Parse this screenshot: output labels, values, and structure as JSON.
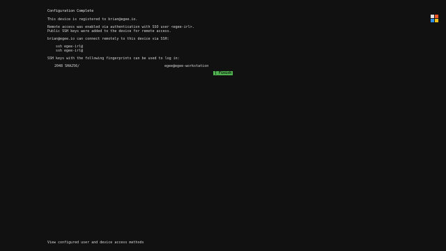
{
  "title": "Configuration Complete",
  "registration_line": "This device is registered to brian@egee.io.",
  "remote_access_line1": "Remote access was enabled via authentication with SSO user <egee-irl>.",
  "remote_access_line2": "Public SSH keys were added to the device for remote access.",
  "connect_intro": "brian@egee.io can connect remotely to this device via SSH:",
  "ssh_commands": [
    "ssh egee-irl@",
    "ssh egee-irl@"
  ],
  "fingerprints_intro": "SSH keys with the following fingerprints can be used to log in:",
  "fingerprint": {
    "key": "2048 SHA256/",
    "host": "egee@egee-workstation"
  },
  "finish_button": "[ Finish ]",
  "status_bar": "View configured user and device access methods",
  "logo_colors": [
    "#e0e0e0",
    "#f05a28",
    "#2f8fe6",
    "#f2c21b"
  ]
}
